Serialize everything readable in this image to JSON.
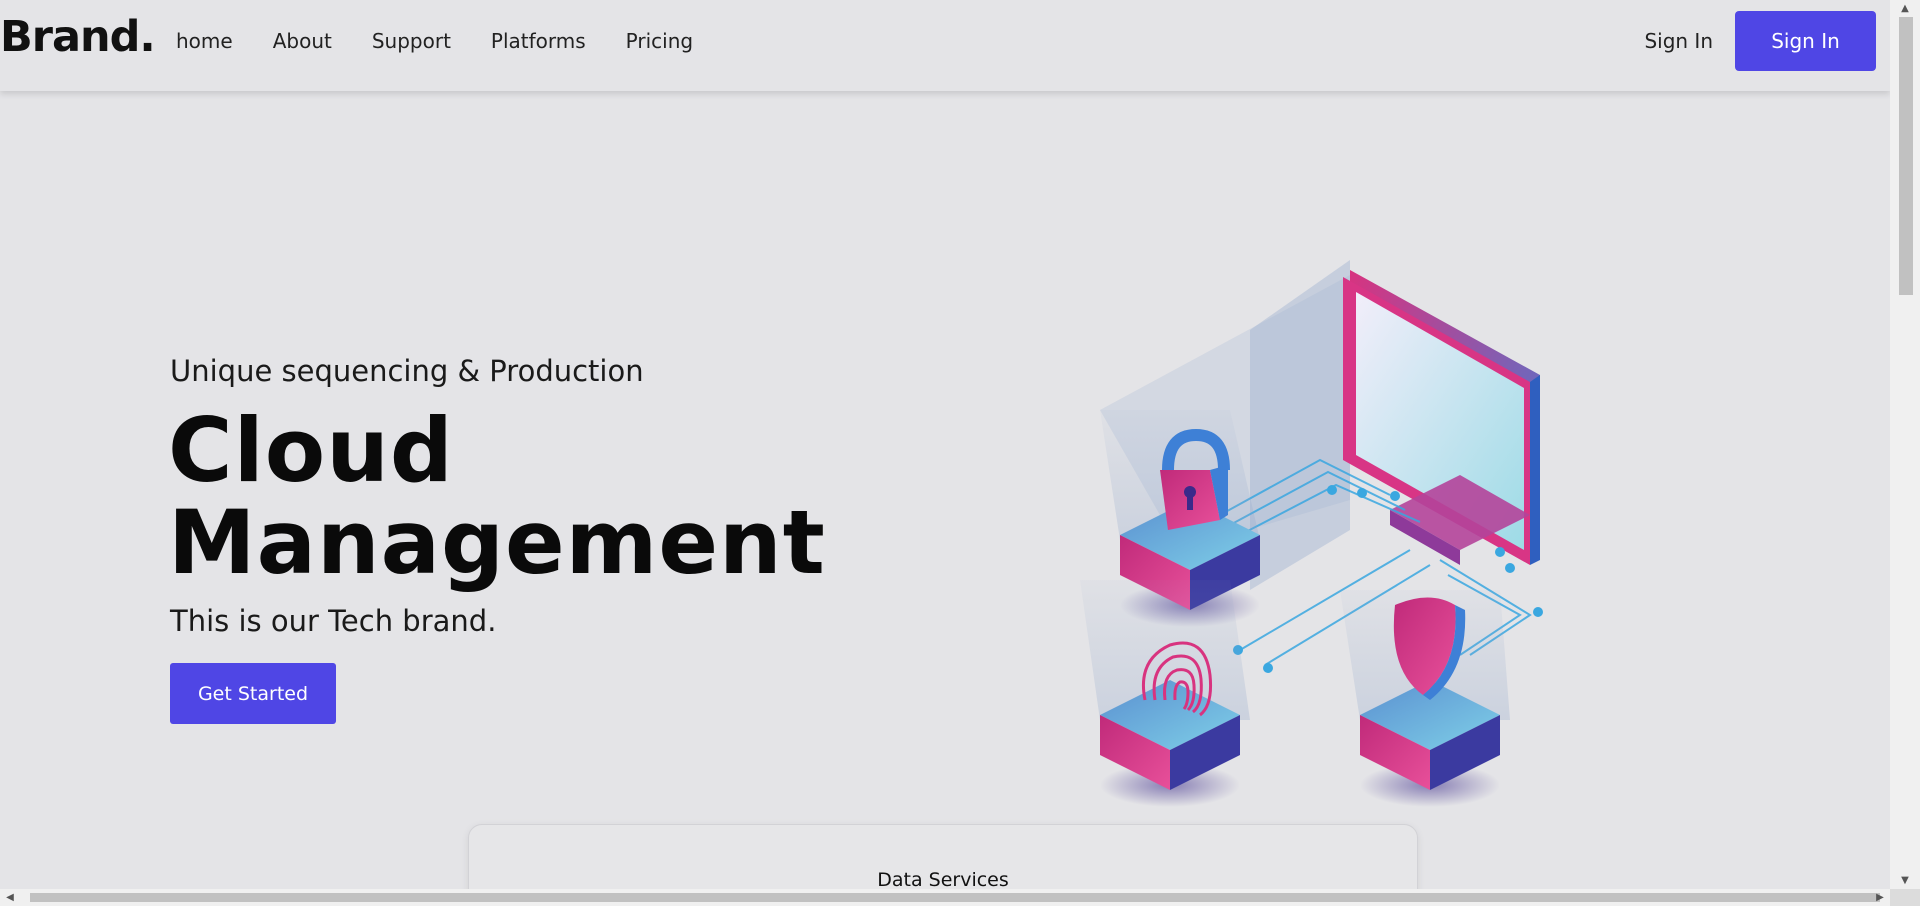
{
  "header": {
    "brand": "Brand.",
    "nav": [
      "home",
      "About",
      "Support",
      "Platforms",
      "Pricing"
    ],
    "signin_link": "Sign In",
    "signin_button": "Sign In"
  },
  "hero": {
    "subtitle": "Unique sequencing & Production",
    "title_line1": "Cloud",
    "title_line2": "Management",
    "description": "This is our Tech brand.",
    "cta": "Get Started"
  },
  "card": {
    "title": "Data Services"
  },
  "colors": {
    "accent": "#4f46e5",
    "background": "#e4e4e7",
    "illustration_pink": "#e0417f",
    "illustration_blue": "#3aa7e0"
  },
  "icons": [
    "lock-icon",
    "fingerprint-icon",
    "shield-icon",
    "monitor-icon"
  ]
}
